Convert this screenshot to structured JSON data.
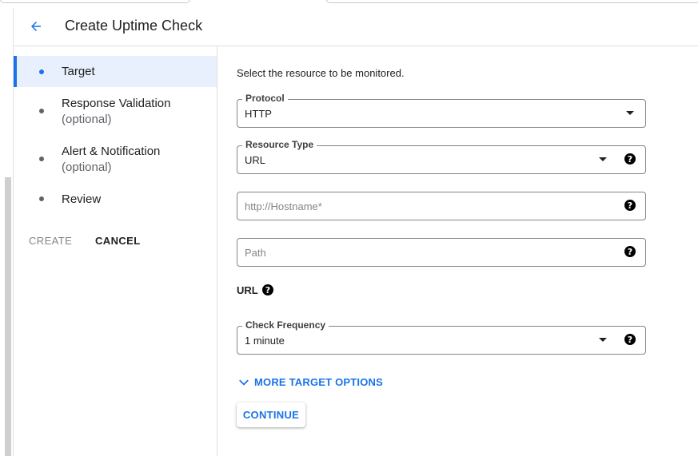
{
  "header": {
    "title": "Create Uptime Check"
  },
  "stepper": {
    "steps": [
      {
        "label": "Target",
        "sublabel": "",
        "active": true
      },
      {
        "label": "Response Validation",
        "sublabel": "(optional)",
        "active": false
      },
      {
        "label": "Alert & Notification",
        "sublabel": "(optional)",
        "active": false
      },
      {
        "label": "Review",
        "sublabel": "",
        "active": false
      }
    ],
    "create_label": "CREATE",
    "cancel_label": "CANCEL"
  },
  "form": {
    "intro": "Select the resource to be monitored.",
    "protocol": {
      "label": "Protocol",
      "value": "HTTP"
    },
    "resource_type": {
      "label": "Resource Type",
      "value": "URL"
    },
    "hostname": {
      "placeholder": "http://Hostname*"
    },
    "path": {
      "placeholder": "Path"
    },
    "url_label": "URL",
    "check_frequency": {
      "label": "Check Frequency",
      "value": "1 minute"
    },
    "more_options_label": "MORE TARGET OPTIONS",
    "continue_label": "CONTINUE"
  },
  "icons": {
    "back": "arrow-back-icon",
    "dropdown": "arrow-drop-down-icon",
    "help": "help-icon",
    "expand": "chevron-down-icon"
  },
  "colors": {
    "accent": "#1a73e8",
    "active_step_bg": "#e8f0fe",
    "text": "#202124",
    "muted": "#5f6368"
  }
}
